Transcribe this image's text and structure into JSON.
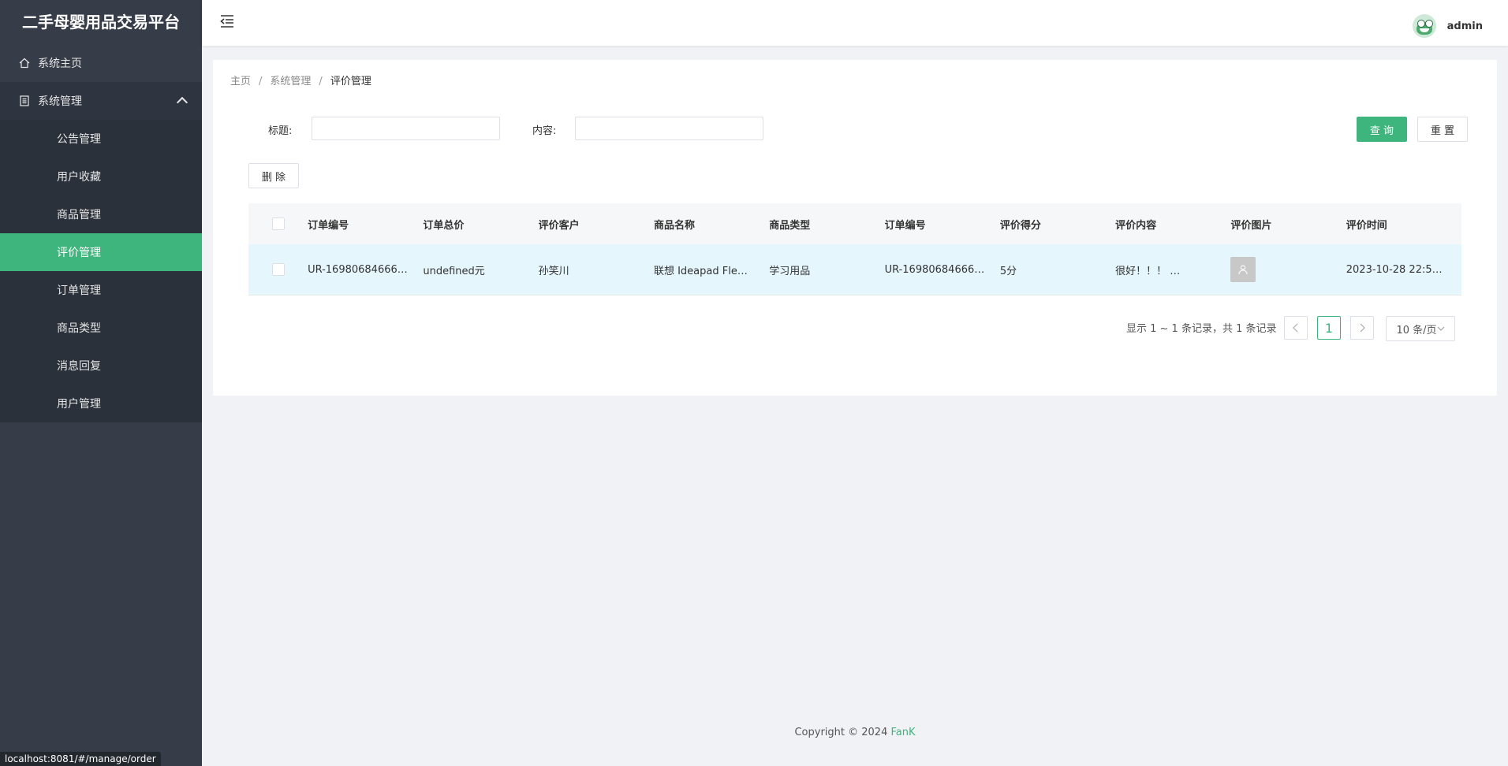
{
  "app": {
    "title": "二手母婴用品交易平台"
  },
  "sidebar": {
    "home_label": "系统主页",
    "group_label": "系统管理",
    "items": [
      {
        "label": "公告管理"
      },
      {
        "label": "用户收藏"
      },
      {
        "label": "商品管理"
      },
      {
        "label": "评价管理",
        "active": true
      },
      {
        "label": "订单管理"
      },
      {
        "label": "商品类型"
      },
      {
        "label": "消息回复"
      },
      {
        "label": "用户管理"
      }
    ]
  },
  "header": {
    "username": "admin"
  },
  "breadcrumb": [
    "主页",
    "系统管理",
    "评价管理"
  ],
  "search": {
    "title_label": "标题:",
    "title_value": "",
    "content_label": "内容:",
    "content_value": "",
    "query_button": "查 询",
    "reset_button": "重 置"
  },
  "toolbar": {
    "delete_button": "删 除"
  },
  "table": {
    "columns": [
      "订单编号",
      "订单总价",
      "评价客户",
      "商品名称",
      "商品类型",
      "订单编号",
      "评价得分",
      "评价内容",
      "评价图片",
      "评价时间"
    ],
    "rows": [
      [
        "UR-16980684666…",
        "undefined元",
        "孙笑川",
        "联想 Ideapad Fle…",
        "学习用品",
        "UR-16980684666…",
        "5分",
        "很好！！！ …",
        "",
        "2023-10-28 22:5…"
      ]
    ]
  },
  "pagination": {
    "info": "显示 1 ~ 1 条记录，共 1 条记录",
    "current_page": "1",
    "page_size": "10 条/页"
  },
  "footer": {
    "text": "Copyright © 2024 ",
    "brand": "FanK"
  },
  "statusbar": {
    "url": "localhost:8081/#/manage/order"
  },
  "colors": {
    "accent": "#3eb57d",
    "sidebar": "#363c48",
    "row_highlight": "#e6f6fd"
  }
}
